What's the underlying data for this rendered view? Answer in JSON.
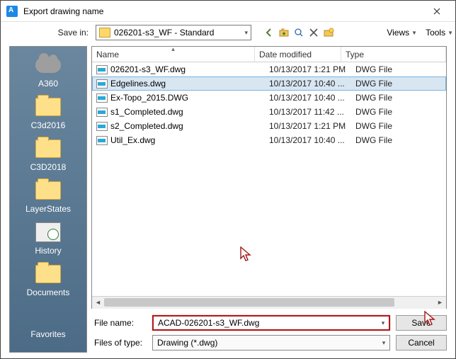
{
  "window": {
    "title": "Export drawing name"
  },
  "toolbar": {
    "save_in_label": "Save in:",
    "current_folder": "026201-s3_WF - Standard",
    "views_label": "Views",
    "tools_label": "Tools"
  },
  "nav_icons": {
    "back": "back-arrow-icon",
    "up": "up-folder-icon",
    "search": "search-web-icon",
    "delete": "delete-icon",
    "newfolder": "new-folder-icon"
  },
  "places": [
    {
      "key": "a360",
      "label": "A360",
      "icon": "cloud"
    },
    {
      "key": "c3d2016",
      "label": "C3d2016",
      "icon": "folder"
    },
    {
      "key": "c3d2018",
      "label": "C3D2018",
      "icon": "folder"
    },
    {
      "key": "layerstates",
      "label": "LayerStates",
      "icon": "folder"
    },
    {
      "key": "history",
      "label": "History",
      "icon": "clock"
    },
    {
      "key": "documents",
      "label": "Documents",
      "icon": "folder"
    },
    {
      "key": "favorites",
      "label": "Favorites",
      "icon": "star"
    }
  ],
  "columns": {
    "name": "Name",
    "date": "Date modified",
    "type": "Type"
  },
  "files": [
    {
      "name": "026201-s3_WF.dwg",
      "date": "10/13/2017 1:21 PM",
      "type": "DWG File",
      "selected": false
    },
    {
      "name": "Edgelines.dwg",
      "date": "10/13/2017 10:40 ...",
      "type": "DWG File",
      "selected": true
    },
    {
      "name": "Ex-Topo_2015.DWG",
      "date": "10/13/2017 10:40 ...",
      "type": "DWG File",
      "selected": false
    },
    {
      "name": "s1_Completed.dwg",
      "date": "10/13/2017 11:42 ...",
      "type": "DWG File",
      "selected": false
    },
    {
      "name": "s2_Completed.dwg",
      "date": "10/13/2017 1:21 PM",
      "type": "DWG File",
      "selected": false
    },
    {
      "name": "Util_Ex.dwg",
      "date": "10/13/2017 10:40 ...",
      "type": "DWG File",
      "selected": false
    }
  ],
  "footer": {
    "filename_label": "File name:",
    "filename_value": "ACAD-026201-s3_WF.dwg",
    "filetype_label": "Files of type:",
    "filetype_value": "Drawing (*.dwg)",
    "save_label": "Save",
    "cancel_label": "Cancel"
  }
}
